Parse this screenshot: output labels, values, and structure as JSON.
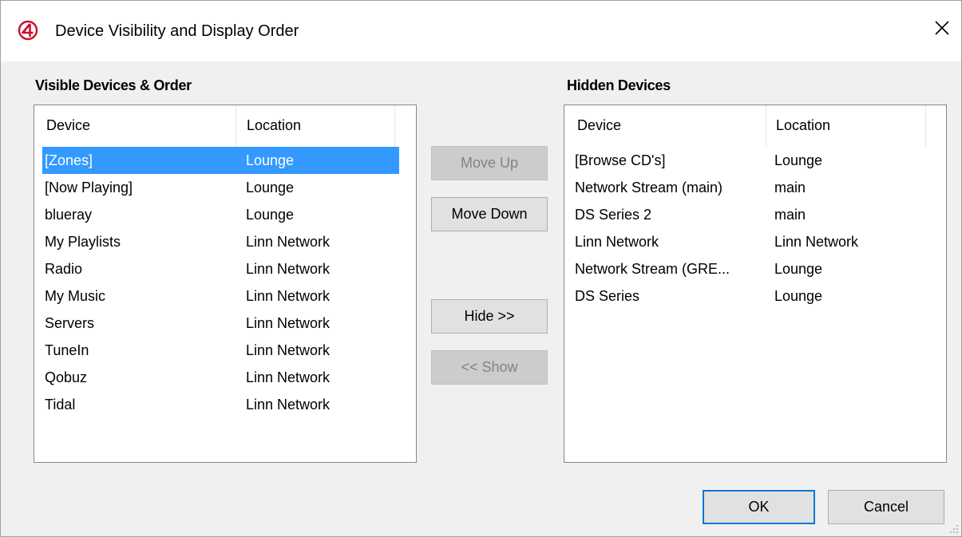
{
  "window": {
    "title": "Device Visibility and Display Order",
    "icon": "c4-logo-icon",
    "accent_color": "#c8102e"
  },
  "visible": {
    "label": "Visible Devices & Order",
    "columns": [
      "Device",
      "Location"
    ],
    "rows": [
      {
        "device": "[Zones]",
        "location": "Lounge",
        "selected": true
      },
      {
        "device": "[Now Playing]",
        "location": "Lounge"
      },
      {
        "device": "blueray",
        "location": "Lounge"
      },
      {
        "device": "My Playlists",
        "location": "Linn Network"
      },
      {
        "device": "Radio",
        "location": "Linn Network"
      },
      {
        "device": "My Music",
        "location": "Linn Network"
      },
      {
        "device": "Servers",
        "location": "Linn Network"
      },
      {
        "device": "TuneIn",
        "location": "Linn Network"
      },
      {
        "device": "Qobuz",
        "location": "Linn Network"
      },
      {
        "device": "Tidal",
        "location": "Linn Network"
      }
    ]
  },
  "hidden": {
    "label": "Hidden Devices",
    "columns": [
      "Device",
      "Location"
    ],
    "rows": [
      {
        "device": "[Browse CD's]",
        "location": "Lounge"
      },
      {
        "device": "Network Stream (main)",
        "location": "main"
      },
      {
        "device": "DS Series 2",
        "location": "main"
      },
      {
        "device": "Linn Network",
        "location": "Linn Network"
      },
      {
        "device": "Network Stream (GRE...",
        "location": "Lounge"
      },
      {
        "device": "DS Series",
        "location": "Lounge"
      }
    ]
  },
  "buttons": {
    "move_up": "Move Up",
    "move_down": "Move Down",
    "hide": "Hide >>",
    "show": "<< Show",
    "ok": "OK",
    "cancel": "Cancel"
  },
  "colors": {
    "selection": "#3399ff",
    "default_button_border": "#0078d7"
  }
}
